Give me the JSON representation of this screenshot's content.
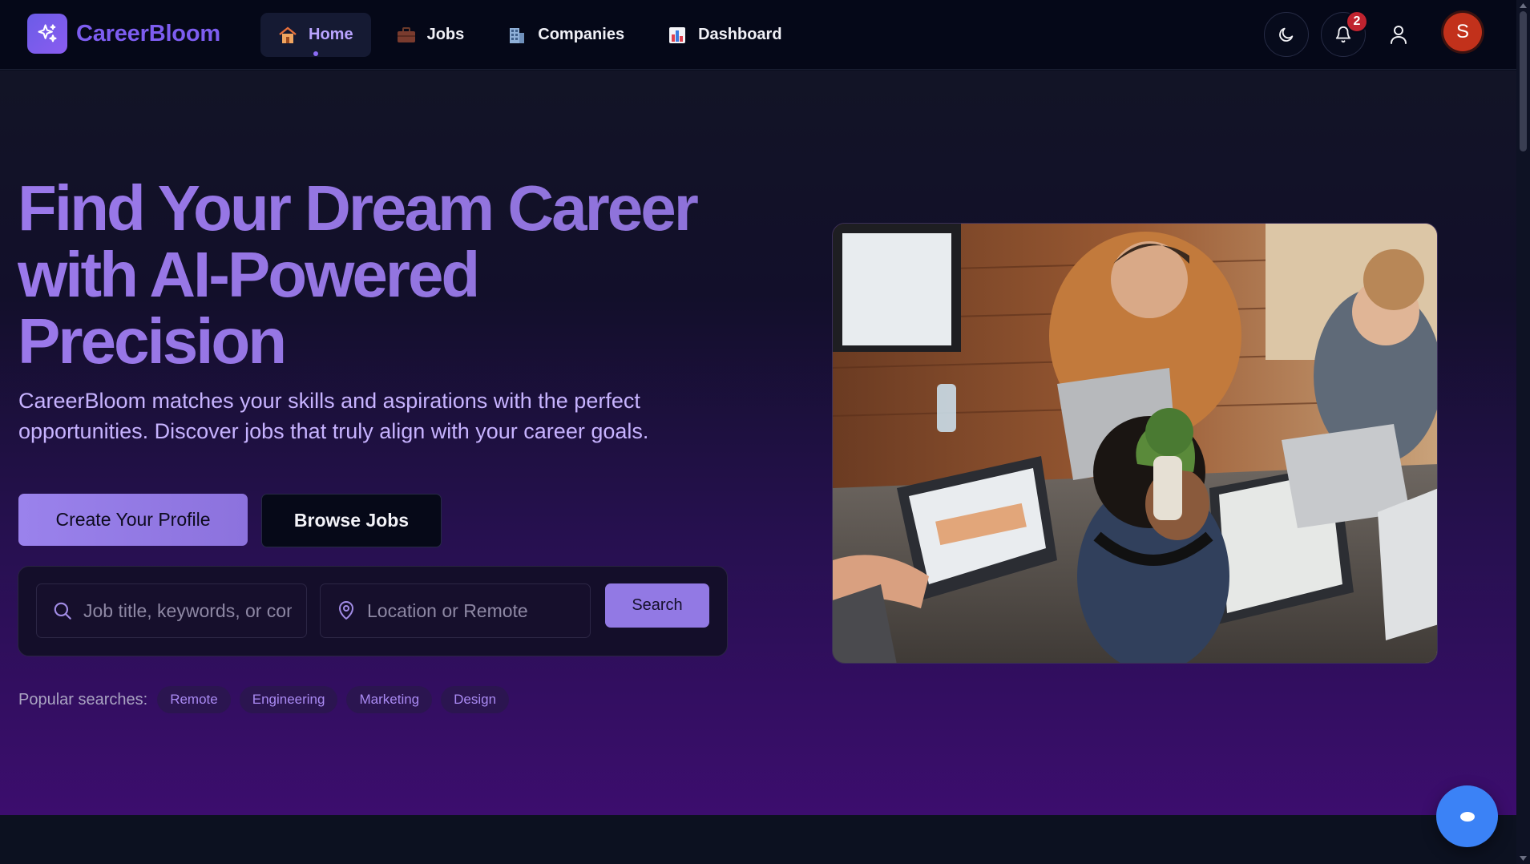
{
  "brand": {
    "name": "CareerBloom",
    "accent": "#7d5df0"
  },
  "nav": {
    "items": [
      {
        "label": "Home",
        "icon": "house-icon",
        "active": true
      },
      {
        "label": "Jobs",
        "icon": "briefcase-icon",
        "active": false
      },
      {
        "label": "Companies",
        "icon": "office-building-icon",
        "active": false
      },
      {
        "label": "Dashboard",
        "icon": "bar-chart-icon",
        "active": false
      }
    ],
    "notifications_count": "2",
    "avatar_initial": "S"
  },
  "hero": {
    "title": "Find Your Dream Career with AI-Powered Precision",
    "subtitle": "CareerBloom matches your skills and aspirations with the perfect opportunities. Discover jobs that truly align with your career goals.",
    "primary_cta": "Create Your Profile",
    "secondary_cta": "Browse Jobs"
  },
  "search": {
    "keyword_placeholder": "Job title, keywords, or company",
    "location_placeholder": "Location or Remote",
    "button_label": "Search"
  },
  "popular": {
    "label": "Popular searches:",
    "tags": [
      "Remote",
      "Engineering",
      "Marketing",
      "Design"
    ]
  },
  "colors": {
    "badge": "#c0232f",
    "avatar": "#c2311b",
    "chat_button": "#3b82f6"
  }
}
